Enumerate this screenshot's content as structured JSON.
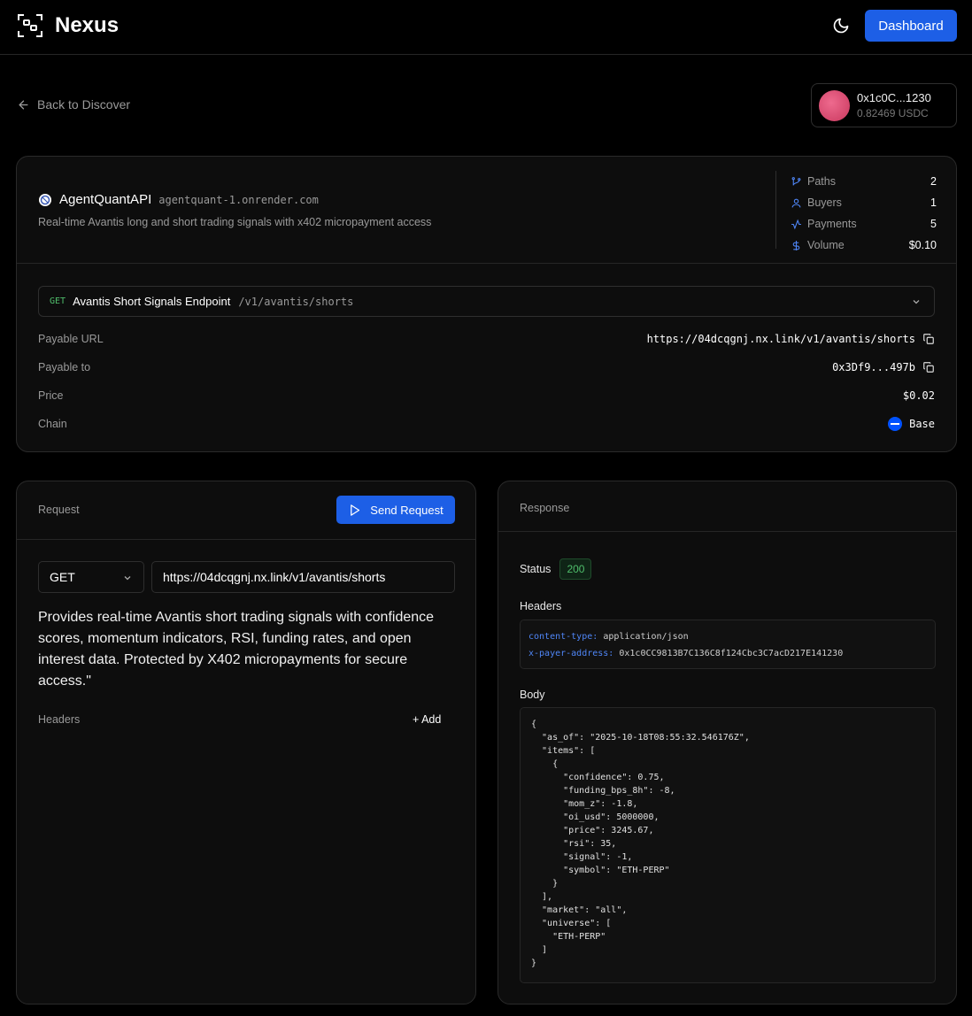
{
  "app": {
    "brand": "Nexus",
    "dashboard_label": "Dashboard"
  },
  "nav": {
    "back_label": "Back to Discover"
  },
  "wallet": {
    "address": "0x1c0C...1230",
    "balance": "0.82469 USDC"
  },
  "api": {
    "name": "AgentQuantAPI",
    "host": "agentquant-1.onrender.com",
    "description": "Real-time Avantis long and short trading signals with x402 micropayment access",
    "stats": [
      {
        "label": "Paths",
        "value": "2",
        "icon": "git-branch-icon"
      },
      {
        "label": "Buyers",
        "value": "1",
        "icon": "user-icon"
      },
      {
        "label": "Payments",
        "value": "5",
        "icon": "activity-icon"
      },
      {
        "label": "Volume",
        "value": "$0.10",
        "icon": "dollar-icon"
      }
    ]
  },
  "endpoint": {
    "method": "GET",
    "name": "Avantis Short Signals Endpoint",
    "path": "/v1/avantis/shorts",
    "payable_url_label": "Payable URL",
    "payable_url": "https://04dcqgnj.nx.link/v1/avantis/shorts",
    "payable_to_label": "Payable to",
    "payable_to": "0x3Df9...497b",
    "price_label": "Price",
    "price": "$0.02",
    "chain_label": "Chain",
    "chain": "Base"
  },
  "request": {
    "title": "Request",
    "send_label": "Send Request",
    "method": "GET",
    "url": "https://04dcqgnj.nx.link/v1/avantis/shorts",
    "description": "Provides real-time Avantis short trading signals with confidence scores, momentum indicators, RSI, funding rates, and open interest data. Protected by X402 micropayments for secure access.\"",
    "headers_label": "Headers",
    "add_label": "+ Add"
  },
  "response": {
    "title": "Response",
    "status_label": "Status",
    "status_code": "200",
    "headers_label": "Headers",
    "headers": [
      {
        "key": "content-type:",
        "value": "application/json"
      },
      {
        "key": "x-payer-address:",
        "value": "0x1c0CC9813B7C136C8f124Cbc3C7acD217E141230"
      }
    ],
    "body_label": "Body",
    "body": "{\n  \"as_of\": \"2025-10-18T08:55:32.546176Z\",\n  \"items\": [\n    {\n      \"confidence\": 0.75,\n      \"funding_bps_8h\": -8,\n      \"mom_z\": -1.8,\n      \"oi_usd\": 5000000,\n      \"price\": 3245.67,\n      \"rsi\": 35,\n      \"signal\": -1,\n      \"symbol\": \"ETH-PERP\"\n    }\n  ],\n  \"market\": \"all\",\n  \"universe\": [\n    \"ETH-PERP\"\n  ]\n}"
  },
  "colors": {
    "accent": "#1d5fe6",
    "success": "#4fbd6b",
    "stat_icon": "#4f86f7"
  }
}
